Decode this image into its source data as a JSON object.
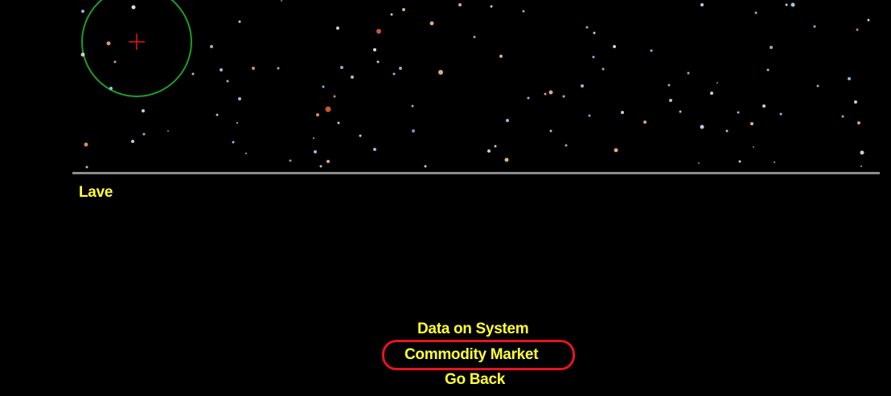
{
  "screen": "short-range-chart",
  "current_system": {
    "name": "Lave"
  },
  "menu": {
    "items": [
      {
        "id": "data",
        "label": "Data on System"
      },
      {
        "id": "market",
        "label": "Commodity Market",
        "highlighted": true
      },
      {
        "id": "back",
        "label": "Go Back"
      }
    ]
  },
  "colors": {
    "background": "#000000",
    "text": "#ffff33",
    "divider": "#8c8c8c",
    "range_circle": "#1e9e28",
    "crosshair": "#e8141e",
    "highlight": "#e8141e"
  },
  "icons": {
    "crosshair": "crosshair-icon",
    "range_circle": "fuel-range-circle"
  }
}
